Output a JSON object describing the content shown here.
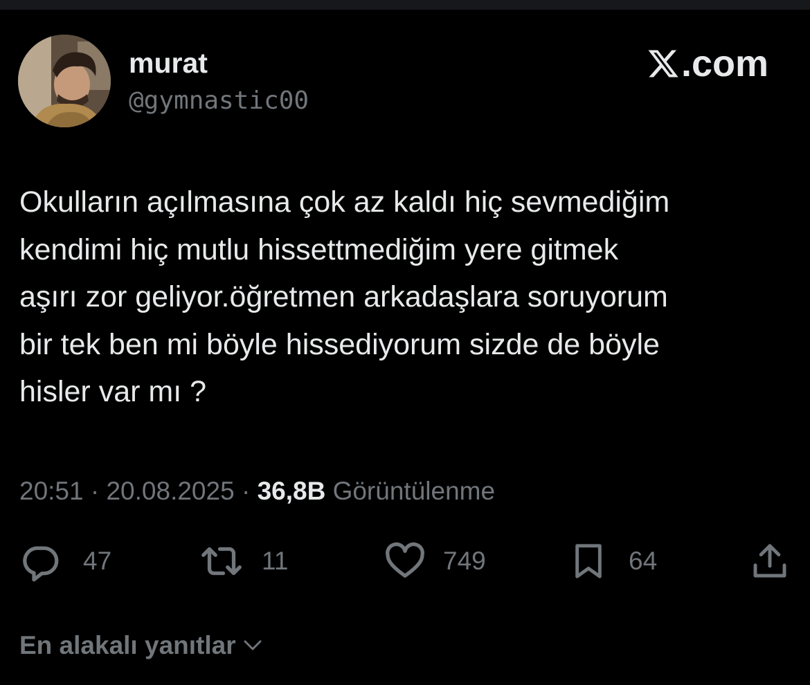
{
  "author": {
    "display_name": "murat",
    "handle": "@gymnastic00"
  },
  "brand": {
    "label": ".com"
  },
  "tweet": {
    "text": "Okulların açılmasına çok az kaldı hiç sevmediğim\nkendimi hiç mutlu hissettmediğim yere gitmek\naşırı zor geliyor.öğretmen arkadaşlara soruyorum\nbir tek ben mi böyle hissediyorum sizde de böyle\nhisler var mı ?",
    "time": "20:51",
    "separator": "·",
    "date": "20.08.2025",
    "views_count": "36,8B",
    "views_label": "Görüntülenme"
  },
  "actions": {
    "reply_count": "47",
    "retweet_count": "11",
    "like_count": "749",
    "bookmark_count": "64"
  },
  "replies": {
    "sort_label": "En alakalı yanıtlar"
  },
  "colors": {
    "background": "#000000",
    "text_primary": "#e7e9ea",
    "text_secondary": "#71767b"
  },
  "icons": [
    "x-logo-icon",
    "reply-icon",
    "retweet-icon",
    "like-icon",
    "bookmark-icon",
    "share-icon",
    "chevron-down-icon"
  ]
}
